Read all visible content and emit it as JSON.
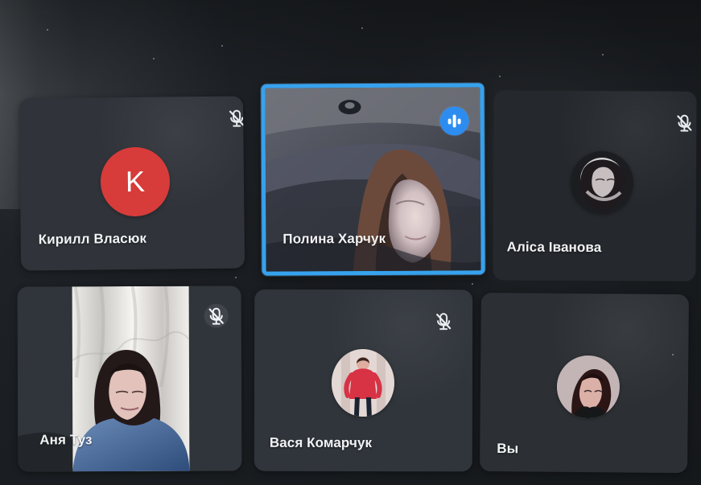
{
  "participants": [
    {
      "name": "Кирилл Власюк",
      "avatar_initial": "K",
      "avatar_color": "#d73c3a",
      "microphone": "mic-off-icon"
    },
    {
      "name": "Полина Харчук",
      "state": "speaking",
      "highlight_color": "#36a2ee",
      "speaking_indicator": "audio-level-icon"
    },
    {
      "name": "Аліса Іванова",
      "avatar": "profile-photo",
      "microphone": "mic-off-icon"
    },
    {
      "name": "Аня Туз",
      "video": "camera-feed",
      "microphone": "mic-off-icon"
    },
    {
      "name": "Вася Комарчук",
      "avatar": "profile-photo",
      "microphone": "mic-off-icon"
    },
    {
      "name": "Вы",
      "avatar": "profile-photo"
    }
  ],
  "theme": {
    "background": "#171a1d",
    "tile": "#2f3338",
    "active_border": "#36a2ee",
    "speaking_badge": "#2d8cf0",
    "avatar_red": "#d73c3a"
  }
}
